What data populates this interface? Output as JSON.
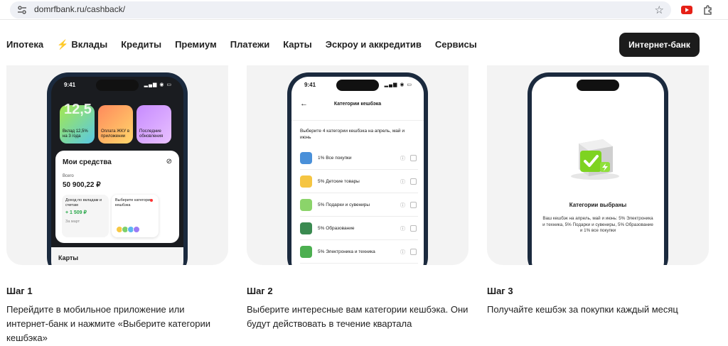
{
  "browser": {
    "url": "domrfbank.ru/cashback/"
  },
  "nav": {
    "items": [
      "Ипотека",
      "Вклады",
      "Кредиты",
      "Премиум",
      "Платежи",
      "Карты",
      "Эскроу и аккредитив",
      "Сервисы"
    ],
    "cta": "Интернет-банк"
  },
  "phone1": {
    "time": "9:41",
    "tiles": [
      {
        "big": "12,5",
        "label": "Вклад 12,5% на 3 года"
      },
      {
        "label": "Оплата ЖКУ в приложении"
      },
      {
        "label": "Последние обновления"
      }
    ],
    "funds_title": "Мои средства",
    "total_label": "Всего",
    "total_amount": "50 900,22 ₽",
    "income_label": "Доход по вкладам и счетам",
    "income_value": "+ 1 509 ₽",
    "income_period": "За март",
    "choose_label": "Выберите категории кешбэка",
    "cards_title": "Карты"
  },
  "phone2": {
    "time": "9:41",
    "title": "Категории кешбэка",
    "intro": "Выберите 4 категории кешбэка на апрель, май и июнь",
    "rows": [
      "1% Все покупки",
      "5% Детские товары",
      "5% Подарки и сувениры",
      "5% Образование",
      "5% Электроника и техника"
    ]
  },
  "phone3": {
    "title": "Категории выбраны",
    "desc": "Ваш кешбэк на апрель, май и июнь: 5% Электроника и техника, 5% Подарки и сувениры, 5% Образование и 1% все покупки"
  },
  "steps": [
    {
      "title": "Шаг 1",
      "text": "Перейдите в мобильное приложение или интернет-банк и нажмите «Выберите категории кешбэка»"
    },
    {
      "title": "Шаг 2",
      "text": "Выберите интересные вам категории кешбэка. Они будут действовать в течение квартала"
    },
    {
      "title": "Шаг 3",
      "text": "Получайте кешбэк за покупки каждый месяц"
    }
  ]
}
